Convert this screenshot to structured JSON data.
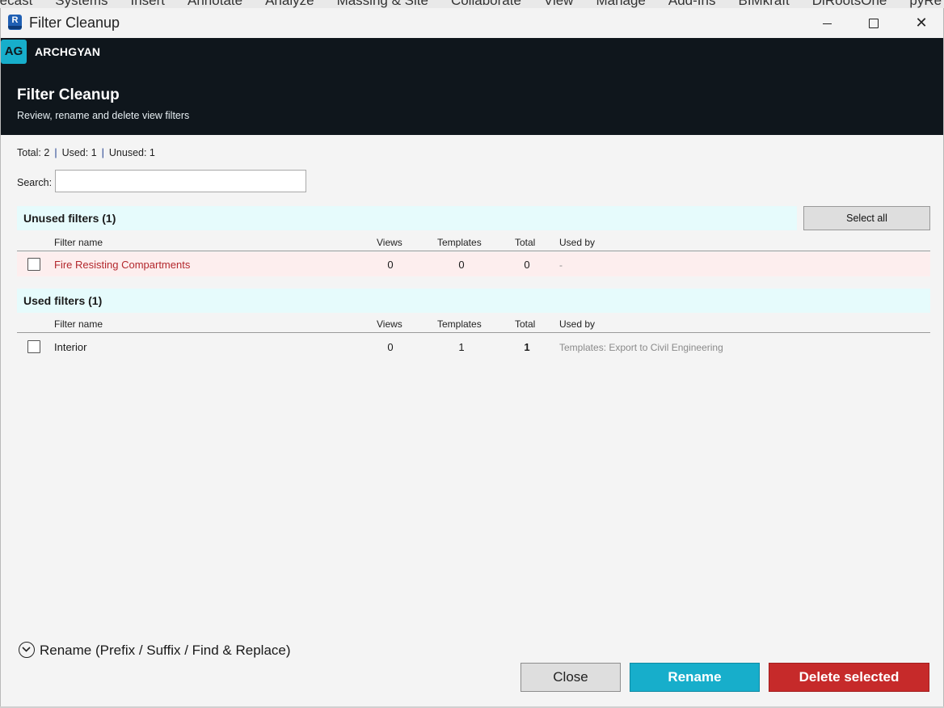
{
  "ribbon": {
    "tabs": [
      "recast",
      "Systems",
      "Insert",
      "Annotate",
      "Analyze",
      "Massing & Site",
      "Collaborate",
      "View",
      "Manage",
      "Add-Ins",
      "BIMkraft",
      "DiRootsOne",
      "pyRe"
    ]
  },
  "window": {
    "title": "Filter Cleanup",
    "app_icon": "revit-icon",
    "min_label": "minimize",
    "max_label": "maximize",
    "close_glyph": "✕"
  },
  "header": {
    "badge": "AG",
    "brand": "ARCHGYAN",
    "title": "Filter Cleanup",
    "subtitle": "Review, rename and delete view filters"
  },
  "summary": {
    "total": "Total: 2",
    "used": "Used: 1",
    "unused": "Unused: 1",
    "separator": "|"
  },
  "search": {
    "label": "Search:",
    "value": ""
  },
  "columns": {
    "name": "Filter name",
    "views": "Views",
    "templates": "Templates",
    "total": "Total",
    "used_by": "Used by"
  },
  "unused_section": {
    "title": "Unused filters (1)",
    "select_all": "Select all",
    "rows": [
      {
        "name": "Fire Resisting Compartments",
        "views": "0",
        "templates": "0",
        "total": "0",
        "used_by": "-"
      }
    ]
  },
  "used_section": {
    "title": "Used filters (1)",
    "rows": [
      {
        "name": "Interior",
        "views": "0",
        "templates": "1",
        "total": "1",
        "used_by": "Templates: Export to Civil Engineering"
      }
    ]
  },
  "rename_expander": {
    "label": "Rename (Prefix / Suffix / Find & Replace)"
  },
  "buttons": {
    "close": "Close",
    "rename": "Rename",
    "delete": "Delete selected"
  },
  "colors": {
    "header_bg": "#0f161c",
    "accent": "#17aecb",
    "danger": "#c62a2a",
    "unused_row": "#fdeeee",
    "section_bg": "#e6fbfc"
  }
}
